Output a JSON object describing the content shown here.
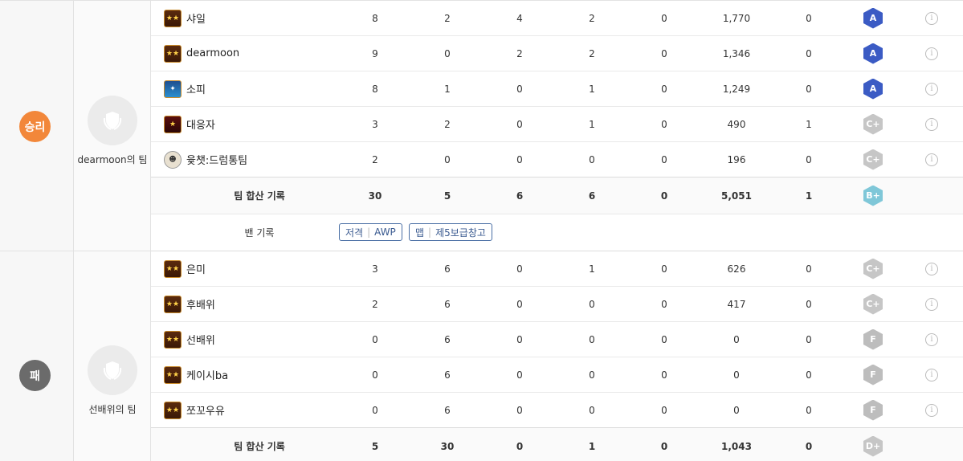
{
  "colors": {
    "win": "#f2873a",
    "lose": "#6b6b6b",
    "grade_A": "#3b5bc4",
    "grade_C_plus": "#c6c6c6",
    "grade_B_plus": "#7fc7d8",
    "grade_F": "#bdbdbd",
    "grade_D_plus": "#c6c6c6"
  },
  "teams": [
    {
      "result": "승리",
      "team_name": "dearmoon의 팀",
      "emblem_icon": "shield-laurel-icon",
      "players": [
        {
          "rank_icon": "rank-stars-icon",
          "name": "샤일",
          "kill": "8",
          "death": "2",
          "assist": "4",
          "c4": "2",
          "defuse": "0",
          "damage": "1,770",
          "mvp": "0",
          "grade": "A"
        },
        {
          "rank_icon": "rank-stars-icon",
          "name": "dearmoon",
          "kill": "9",
          "death": "0",
          "assist": "2",
          "c4": "2",
          "defuse": "0",
          "damage": "1,346",
          "mvp": "0",
          "grade": "A"
        },
        {
          "rank_icon": "rank-wing-icon",
          "name": "소피",
          "kill": "8",
          "death": "1",
          "assist": "0",
          "c4": "1",
          "defuse": "0",
          "damage": "1,249",
          "mvp": "0",
          "grade": "A"
        },
        {
          "rank_icon": "rank-single-star-icon",
          "name": "대응자",
          "kill": "3",
          "death": "2",
          "assist": "0",
          "c4": "1",
          "defuse": "0",
          "damage": "490",
          "mvp": "1",
          "grade": "C+"
        },
        {
          "rank_icon": "rank-character-icon",
          "name": "윷챗:드럼통팀",
          "kill": "2",
          "death": "0",
          "assist": "0",
          "c4": "0",
          "defuse": "0",
          "damage": "196",
          "mvp": "0",
          "grade": "C+"
        }
      ],
      "total": {
        "label": "팀 합산 기록",
        "kill": "30",
        "death": "5",
        "assist": "6",
        "c4": "6",
        "defuse": "0",
        "damage": "5,051",
        "mvp": "1",
        "grade": "B+"
      },
      "ban": {
        "label": "밴 기록",
        "chips": [
          {
            "type": "저격",
            "value": "AWP"
          },
          {
            "type": "맵",
            "value": "제5보급창고"
          }
        ]
      }
    },
    {
      "result": "패",
      "team_name": "선배위의 팀",
      "emblem_icon": "shield-laurel-icon",
      "players": [
        {
          "rank_icon": "rank-stars-icon",
          "name": "은미",
          "kill": "3",
          "death": "6",
          "assist": "0",
          "c4": "1",
          "defuse": "0",
          "damage": "626",
          "mvp": "0",
          "grade": "C+"
        },
        {
          "rank_icon": "rank-stars-icon",
          "name": "후배위",
          "kill": "2",
          "death": "6",
          "assist": "0",
          "c4": "0",
          "defuse": "0",
          "damage": "417",
          "mvp": "0",
          "grade": "C+"
        },
        {
          "rank_icon": "rank-stars-icon",
          "name": "선배위",
          "kill": "0",
          "death": "6",
          "assist": "0",
          "c4": "0",
          "defuse": "0",
          "damage": "0",
          "mvp": "0",
          "grade": "F"
        },
        {
          "rank_icon": "rank-stars-icon",
          "name": "케이시ba",
          "kill": "0",
          "death": "6",
          "assist": "0",
          "c4": "0",
          "defuse": "0",
          "damage": "0",
          "mvp": "0",
          "grade": "F"
        },
        {
          "rank_icon": "rank-stars-icon",
          "name": "쪼꼬우유",
          "kill": "0",
          "death": "6",
          "assist": "0",
          "c4": "0",
          "defuse": "0",
          "damage": "0",
          "mvp": "0",
          "grade": "F"
        }
      ],
      "total": {
        "label": "팀 합산 기록",
        "kill": "5",
        "death": "30",
        "assist": "0",
        "c4": "1",
        "defuse": "0",
        "damage": "1,043",
        "mvp": "0",
        "grade": "D+"
      }
    }
  ]
}
